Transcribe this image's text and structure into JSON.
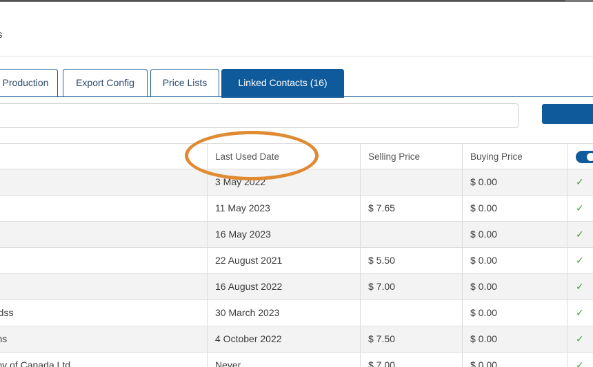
{
  "page": {
    "title": "s"
  },
  "tabs": [
    {
      "label": "Production",
      "active": false
    },
    {
      "label": "Export Config",
      "active": false
    },
    {
      "label": "Price Lists",
      "active": false
    },
    {
      "label": "Linked Contacts (16)",
      "active": true
    }
  ],
  "search": {
    "value": "",
    "placeholder": ""
  },
  "table": {
    "headers": {
      "name": "",
      "last_used_date": "Last Used Date",
      "selling_price": "Selling Price",
      "buying_price": "Buying Price"
    },
    "rows": [
      {
        "name": "",
        "date": "3 May 2022",
        "selling": "",
        "buying": "$ 0.00",
        "check": "✓"
      },
      {
        "name": "",
        "date": "11 May 2023",
        "selling": "$ 7.65",
        "buying": "$ 0.00",
        "check": "✓"
      },
      {
        "name": "",
        "date": "16 May 2023",
        "selling": "",
        "buying": "$ 0.00",
        "check": "✓"
      },
      {
        "name": "",
        "date": "22 August 2021",
        "selling": "$ 5.50",
        "buying": "$ 0.00",
        "check": "✓"
      },
      {
        "name": "",
        "date": "16 August 2022",
        "selling": "$ 7.00",
        "buying": "$ 0.00",
        "check": "✓"
      },
      {
        "name": "ynoldss",
        "date": "30 March 2023",
        "selling": "",
        "buying": "$ 0.00",
        "check": "✓"
      },
      {
        "name": "gahns",
        "date": "4 October 2022",
        "selling": "$ 7.50",
        "buying": "$ 0.00",
        "check": "✓"
      },
      {
        "name": "npany of Canada Ltd",
        "date": "Never",
        "selling": "$ 7.00",
        "buying": "$ 0.00",
        "check": "✓"
      }
    ]
  },
  "colors": {
    "accent": "#0f5a9a",
    "highlight": "#e08a32",
    "check": "#3aa63a"
  }
}
